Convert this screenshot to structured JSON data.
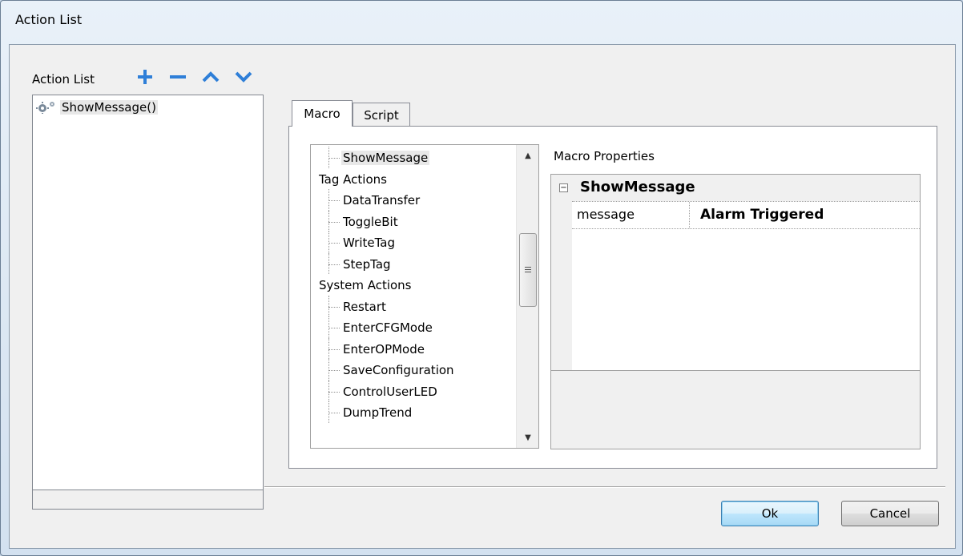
{
  "window": {
    "title": "Action List"
  },
  "left": {
    "label": "Action List",
    "toolbar": [
      {
        "name": "add-icon",
        "glyph": "+"
      },
      {
        "name": "remove-icon",
        "glyph": "−"
      },
      {
        "name": "move-up-icon",
        "glyph": "^"
      },
      {
        "name": "move-down-icon",
        "glyph": "v"
      }
    ],
    "items": [
      {
        "label": "ShowMessage()",
        "icon": "gear-icon"
      }
    ]
  },
  "tabs": [
    {
      "label": "Macro",
      "active": true
    },
    {
      "label": "Script",
      "active": false
    }
  ],
  "tree": {
    "rows": [
      {
        "label": "ShowMessage",
        "level": 1,
        "selected": true
      },
      {
        "label": "Tag Actions",
        "level": 0
      },
      {
        "label": "DataTransfer",
        "level": 1
      },
      {
        "label": "ToggleBit",
        "level": 1
      },
      {
        "label": "WriteTag",
        "level": 1
      },
      {
        "label": "StepTag",
        "level": 1
      },
      {
        "label": "System Actions",
        "level": 0
      },
      {
        "label": "Restart",
        "level": 1
      },
      {
        "label": "EnterCFGMode",
        "level": 1
      },
      {
        "label": "EnterOPMode",
        "level": 1
      },
      {
        "label": "SaveConfiguration",
        "level": 1
      },
      {
        "label": "ControlUserLED",
        "level": 1
      },
      {
        "label": "DumpTrend",
        "level": 1
      }
    ]
  },
  "properties": {
    "label": "Macro Properties",
    "category": "ShowMessage",
    "collapse_glyph": "−",
    "rows": [
      {
        "key": "message",
        "value": "Alarm Triggered"
      }
    ]
  },
  "buttons": {
    "ok": "Ok",
    "cancel": "Cancel"
  },
  "colors": {
    "accent_icon": "#2f7fd8",
    "window_bg": "#f0f0f0"
  }
}
